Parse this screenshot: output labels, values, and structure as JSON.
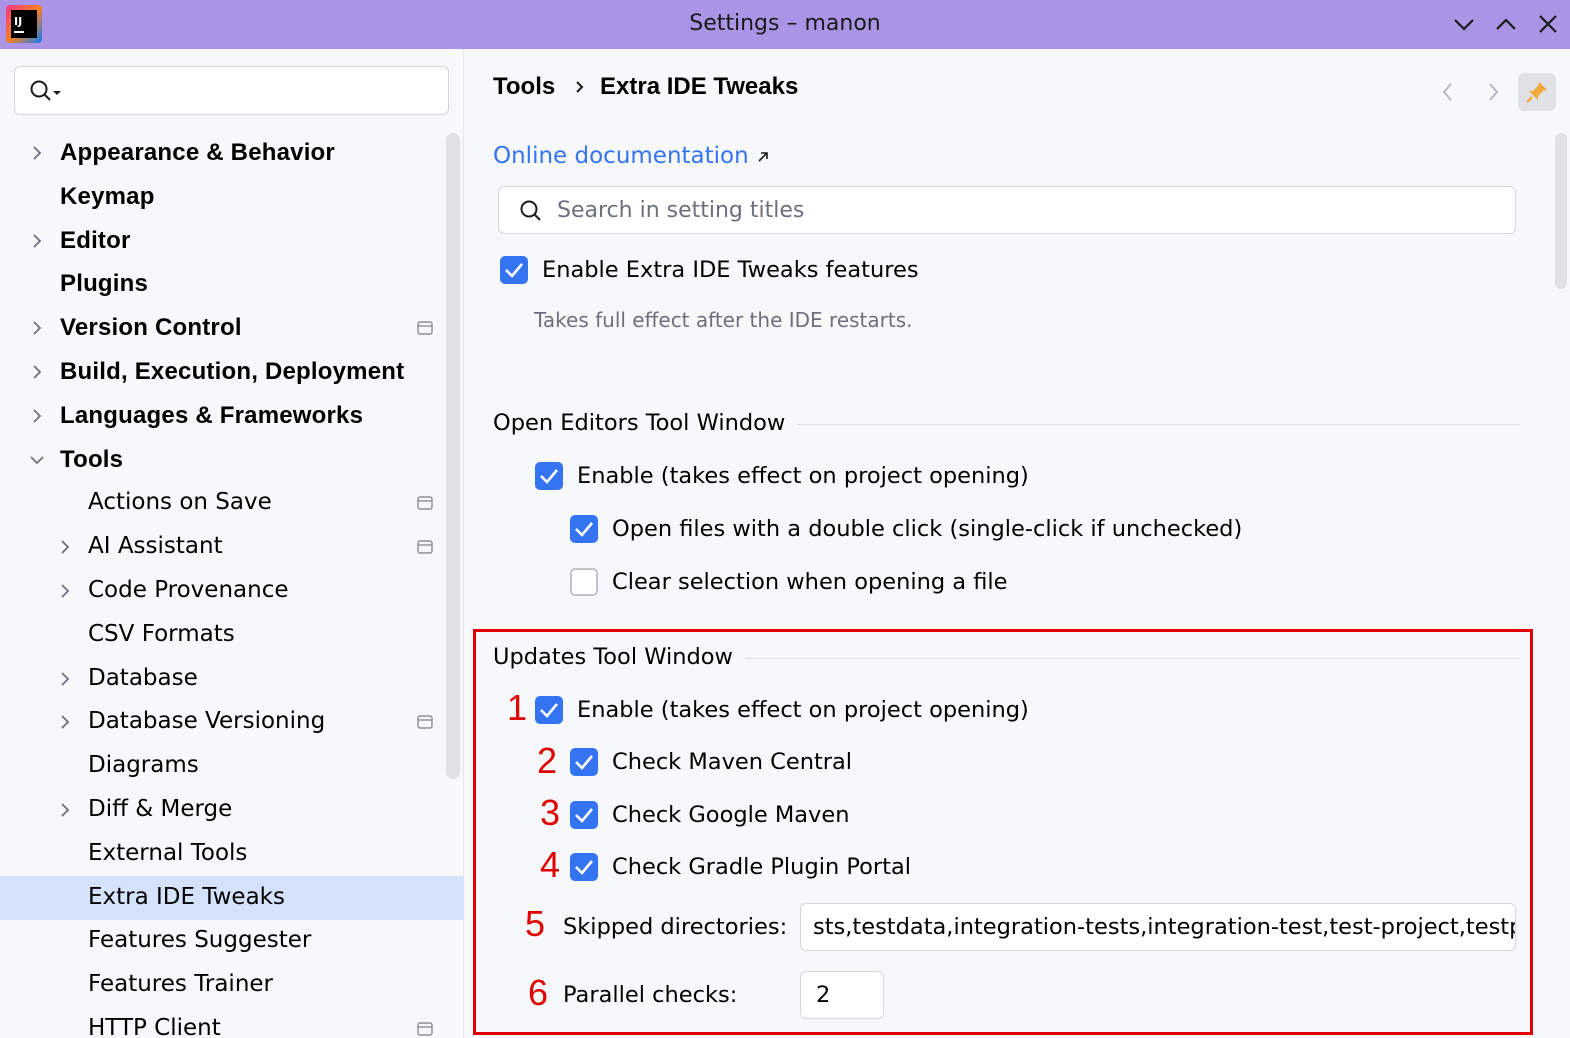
{
  "window": {
    "title": "Settings – manon"
  },
  "left_panel": {
    "search_placeholder": "",
    "tree": [
      {
        "label": "Appearance & Behavior",
        "level": 0,
        "expandable": true,
        "expanded": false,
        "project_badge": false
      },
      {
        "label": "Keymap",
        "level": 0,
        "expandable": false,
        "project_badge": false
      },
      {
        "label": "Editor",
        "level": 0,
        "expandable": true,
        "expanded": false,
        "project_badge": false
      },
      {
        "label": "Plugins",
        "level": 0,
        "expandable": false,
        "project_badge": false
      },
      {
        "label": "Version Control",
        "level": 0,
        "expandable": true,
        "expanded": false,
        "project_badge": true
      },
      {
        "label": "Build, Execution, Deployment",
        "level": 0,
        "expandable": true,
        "expanded": false,
        "project_badge": false
      },
      {
        "label": "Languages & Frameworks",
        "level": 0,
        "expandable": true,
        "expanded": false,
        "project_badge": false
      },
      {
        "label": "Tools",
        "level": 0,
        "expandable": true,
        "expanded": true,
        "project_badge": false
      },
      {
        "label": "Actions on Save",
        "level": 1,
        "expandable": false,
        "project_badge": true
      },
      {
        "label": "AI Assistant",
        "level": 1,
        "expandable": true,
        "expanded": false,
        "project_badge": true
      },
      {
        "label": "Code Provenance",
        "level": 1,
        "expandable": true,
        "expanded": false,
        "project_badge": false
      },
      {
        "label": "CSV Formats",
        "level": 1,
        "expandable": false,
        "project_badge": false
      },
      {
        "label": "Database",
        "level": 1,
        "expandable": true,
        "expanded": false,
        "project_badge": false
      },
      {
        "label": "Database Versioning",
        "level": 1,
        "expandable": true,
        "expanded": false,
        "project_badge": true
      },
      {
        "label": "Diagrams",
        "level": 1,
        "expandable": false,
        "project_badge": false
      },
      {
        "label": "Diff & Merge",
        "level": 1,
        "expandable": true,
        "expanded": false,
        "project_badge": false
      },
      {
        "label": "External Tools",
        "level": 1,
        "expandable": false,
        "project_badge": false
      },
      {
        "label": "Extra IDE Tweaks",
        "level": 1,
        "expandable": false,
        "project_badge": false,
        "selected": true
      },
      {
        "label": "Features Suggester",
        "level": 1,
        "expandable": false,
        "project_badge": false
      },
      {
        "label": "Features Trainer",
        "level": 1,
        "expandable": false,
        "project_badge": false
      },
      {
        "label": "HTTP Client",
        "level": 1,
        "expandable": false,
        "project_badge": true
      }
    ]
  },
  "breadcrumb": {
    "parent": "Tools",
    "separator": "›",
    "current": "Extra IDE Tweaks"
  },
  "content": {
    "doc_link": "Online documentation",
    "search_placeholder": "Search in setting titles",
    "enable_feature": {
      "label": "Enable Extra IDE Tweaks features",
      "checked": true
    },
    "restart_hint": "Takes full effect after the IDE restarts.",
    "open_editors": {
      "title": "Open Editors Tool Window",
      "enable": {
        "label": "Enable (takes effect on project opening)",
        "checked": true
      },
      "double_click": {
        "label": "Open files with a double click (single-click if unchecked)",
        "checked": true
      },
      "clear_selection": {
        "label": "Clear selection when opening a file",
        "checked": false
      }
    },
    "updates": {
      "title": "Updates Tool Window",
      "enable": {
        "label": "Enable (takes effect on project opening)",
        "checked": true,
        "marker": "1"
      },
      "maven_central": {
        "label": "Check Maven Central",
        "checked": true,
        "marker": "2"
      },
      "google_maven": {
        "label": "Check Google Maven",
        "checked": true,
        "marker": "3"
      },
      "gradle_portal": {
        "label": "Check Gradle Plugin Portal",
        "checked": true,
        "marker": "4"
      },
      "skipped_dirs": {
        "label": "Skipped directories:",
        "value": "sts,testdata,integration-tests,integration-test,test-project,testprc",
        "marker": "5"
      },
      "parallel": {
        "label": "Parallel checks:",
        "value": "2",
        "marker": "6"
      }
    }
  },
  "colors": {
    "titlebar": "#ab94e6",
    "accent": "#3574f0",
    "selection": "#d4e2fc",
    "annotation": "#e00000"
  }
}
